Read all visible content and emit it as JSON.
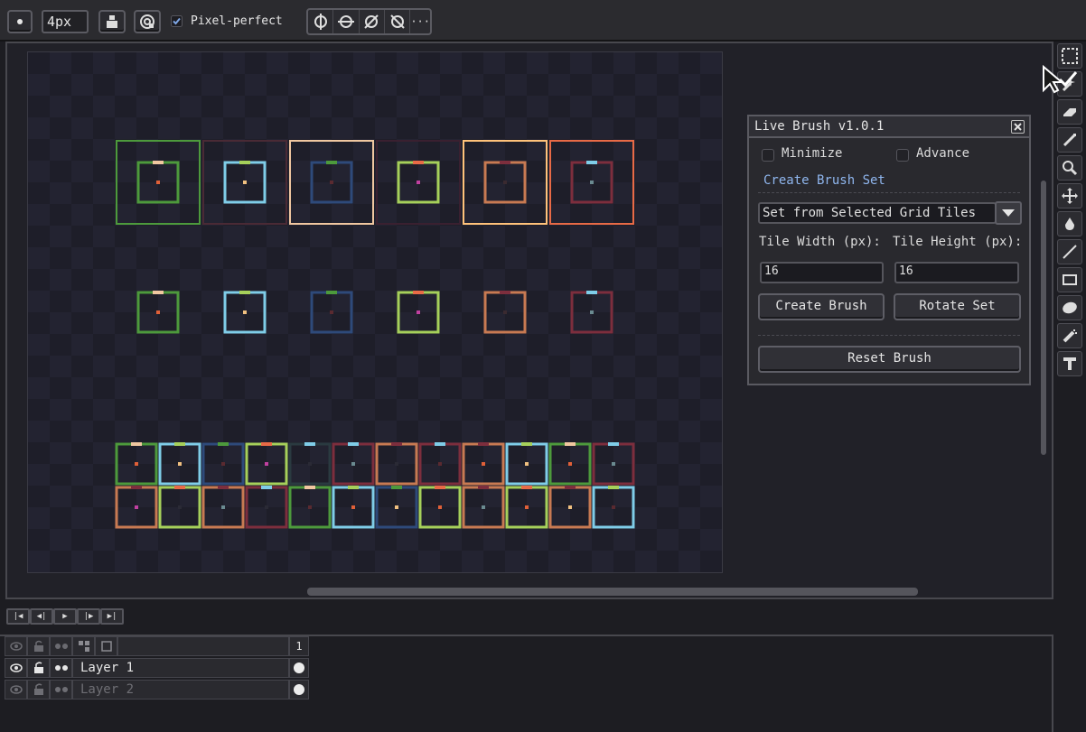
{
  "toolbar": {
    "brush_size": "4px",
    "pixel_perfect_label": "Pixel-perfect",
    "pixel_perfect_checked": true,
    "icons": [
      "dot-icon",
      "brush-size-field",
      "ink-icon",
      "pressure-icon",
      "checkbox-icon",
      "symmetry-vertical-icon",
      "symmetry-horizontal-icon",
      "symmetry-diagonal-icon",
      "symmetry-antidiagonal-icon",
      "more-icon"
    ]
  },
  "live_brush": {
    "title": "Live Brush v1.0.1",
    "minimize_label": "Minimize",
    "advance_label": "Advance",
    "create_set_label": "Create Brush Set",
    "source_option": "Set from Selected Grid Tiles",
    "tile_width_label": "Tile Width (px):",
    "tile_height_label": "Tile Height (px):",
    "tile_width": "16",
    "tile_height": "16",
    "create_brush": "Create Brush",
    "rotate_set": "Rotate Set",
    "reset_brush": "Reset Brush"
  },
  "tools": [
    "marquee-icon",
    "magic-wand-icon",
    "eraser-icon",
    "pencil-icon",
    "zoom-icon",
    "move-icon",
    "paint-bucket-icon",
    "line-icon",
    "rectangle-icon",
    "ellipse-icon",
    "spray-icon",
    "text-icon"
  ],
  "playback": [
    "first-frame-icon",
    "previous-frame-icon",
    "play-icon",
    "next-frame-icon",
    "last-frame-icon"
  ],
  "timeline": {
    "frame_number": "1",
    "header_icons": [
      "visibility-icon",
      "lock-icon",
      "continuous-icon",
      "link-icon",
      "new-group-icon"
    ],
    "layers": [
      {
        "name": "Layer 1",
        "active": true
      },
      {
        "name": "Layer 2",
        "active": false
      }
    ]
  },
  "colors": {
    "accent_link": "#8fb6ee",
    "palette": [
      "#4d9a3c",
      "#7fcde8",
      "#f0c7a0",
      "#a6d05a",
      "#ffc27a",
      "#e86a46",
      "#c87a52",
      "#2e4a7a",
      "#7d2e3d"
    ]
  }
}
